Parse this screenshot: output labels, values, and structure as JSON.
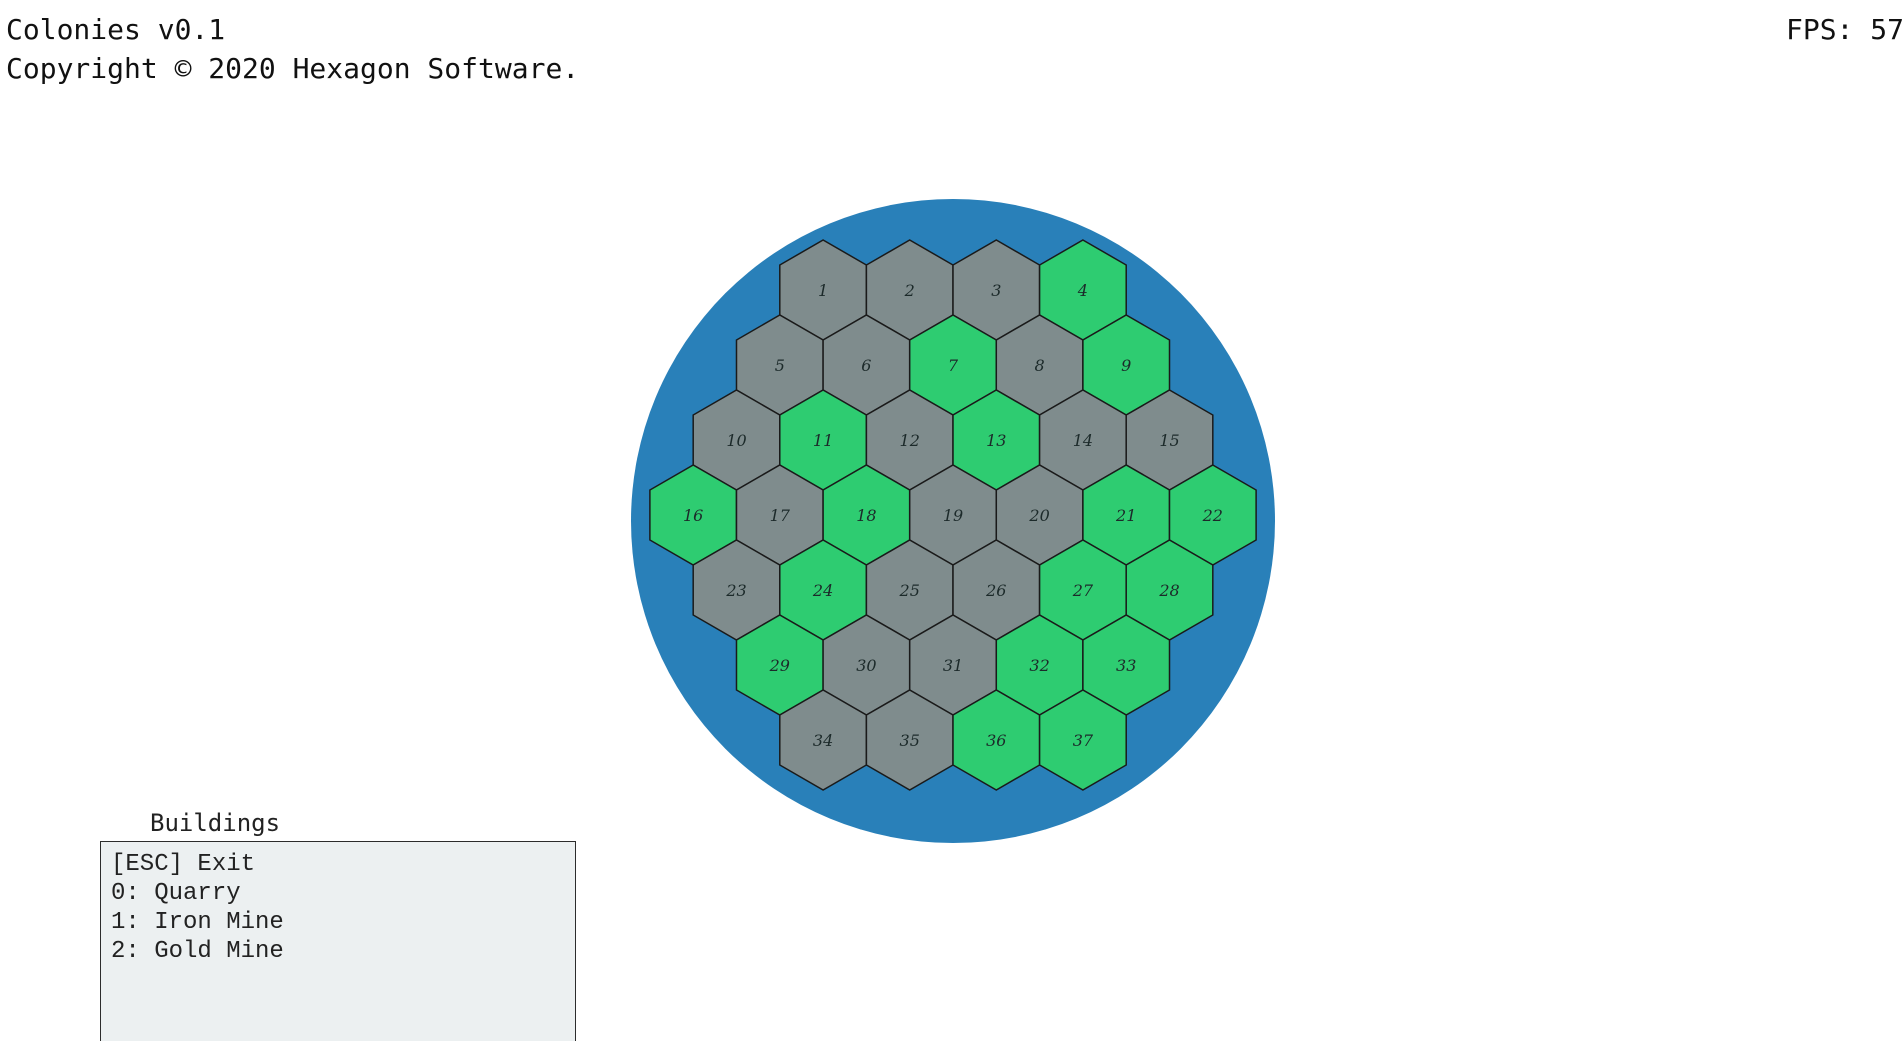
{
  "header": {
    "title": "Colonies v0.1",
    "copyright": "Copyright © 2020 Hexagon Software.",
    "fps": "FPS: 57"
  },
  "board": {
    "water_color": "#2980b9",
    "land_colors": {
      "rock": "#7f8c8d",
      "grass": "#2ecc71"
    },
    "rows": [
      [
        "rock",
        "rock",
        "rock",
        "grass"
      ],
      [
        "rock",
        "rock",
        "grass",
        "rock",
        "grass"
      ],
      [
        "rock",
        "grass",
        "rock",
        "grass",
        "rock",
        "rock"
      ],
      [
        "grass",
        "rock",
        "grass",
        "rock",
        "rock",
        "grass",
        "grass"
      ],
      [
        "rock",
        "grass",
        "rock",
        "rock",
        "grass",
        "grass"
      ],
      [
        "grass",
        "rock",
        "rock",
        "grass",
        "grass"
      ],
      [
        "rock",
        "rock",
        "grass",
        "grass"
      ]
    ],
    "labels": [
      "1",
      "2",
      "3",
      "4",
      "5",
      "6",
      "7",
      "8",
      "9",
      "10",
      "11",
      "12",
      "13",
      "14",
      "15",
      "16",
      "17",
      "18",
      "19",
      "20",
      "21",
      "22",
      "23",
      "24",
      "25",
      "26",
      "27",
      "28",
      "29",
      "30",
      "31",
      "32",
      "33",
      "34",
      "35",
      "36",
      "37"
    ]
  },
  "buildings_menu": {
    "title": "Buildings",
    "items": [
      "[ESC] Exit",
      "0: Quarry",
      "1: Iron Mine",
      "2: Gold Mine"
    ],
    "background_color": "#ecf0f1"
  }
}
